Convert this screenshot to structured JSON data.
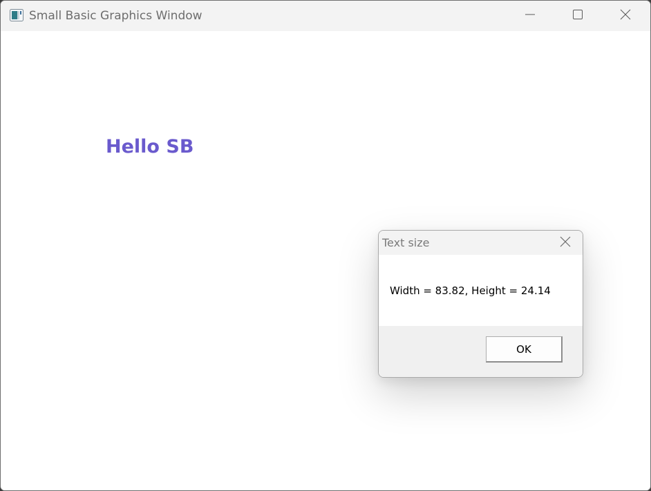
{
  "window": {
    "title": "Small Basic Graphics Window",
    "icon": "small-basic-app-icon",
    "controls": {
      "minimize_icon": "minimize-icon",
      "maximize_icon": "maximize-icon",
      "close_icon": "close-icon"
    }
  },
  "canvas": {
    "text": "Hello SB",
    "text_color": "#6a5acd",
    "background": "#ffffff"
  },
  "dialog": {
    "title": "Text size",
    "message": "Width = 83.82, Height = 24.14",
    "ok_label": "OK",
    "close_icon": "close-icon"
  }
}
